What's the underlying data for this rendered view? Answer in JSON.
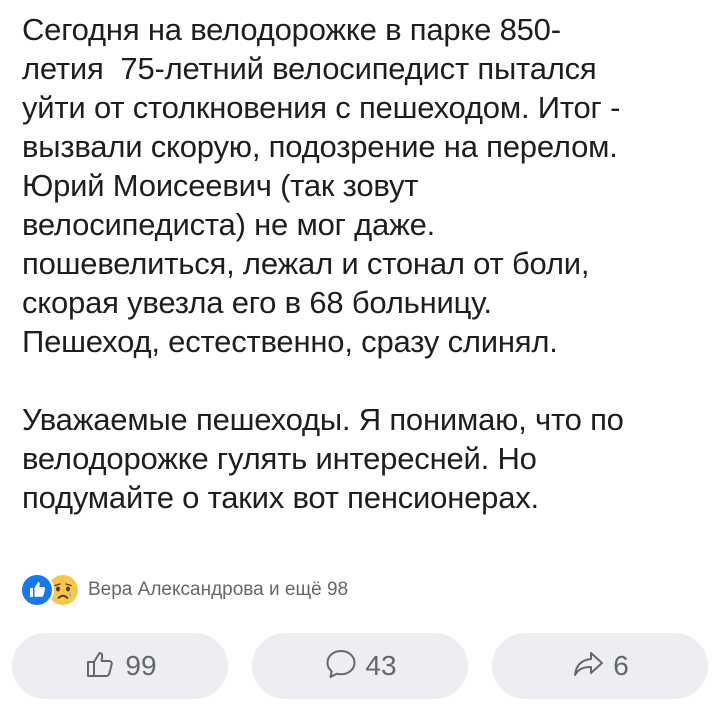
{
  "post": {
    "paragraphs": [
      {
        "lines": [
          "Сегодня на велодорожке в парке 850-",
          "летия  75-летний велосипедист пытался",
          "уйти от столкновения с пешеходом. Итог -",
          "вызвали скорую, подозрение на перелом.",
          "Юрий Моисеевич (так зовут",
          "велосипедиста) не мог даже.",
          "пошевелиться, лежал и стонал от боли,",
          "скорая увезла его в 68 больницу.",
          "Пешеход, естественно, сразу слинял."
        ]
      },
      {
        "lines": [
          "Уважаемые пешеходы. Я понимаю, что по",
          "велодорожке гулять интересней. Но",
          "подумайте о таких вот пенсионерах."
        ]
      }
    ]
  },
  "reactions": {
    "icons": [
      "like-reaction-icon",
      "sad-reaction-icon"
    ],
    "summary": "Вера Александрова и ещё 98"
  },
  "actions": {
    "like_count": "99",
    "comment_count": "43",
    "share_count": "6"
  },
  "colors": {
    "text": "#1c1e21",
    "secondary": "#65676b",
    "button_bg": "#eceef1",
    "like_blue": "#1877f2",
    "sad_yellow": "#f7c64a"
  }
}
